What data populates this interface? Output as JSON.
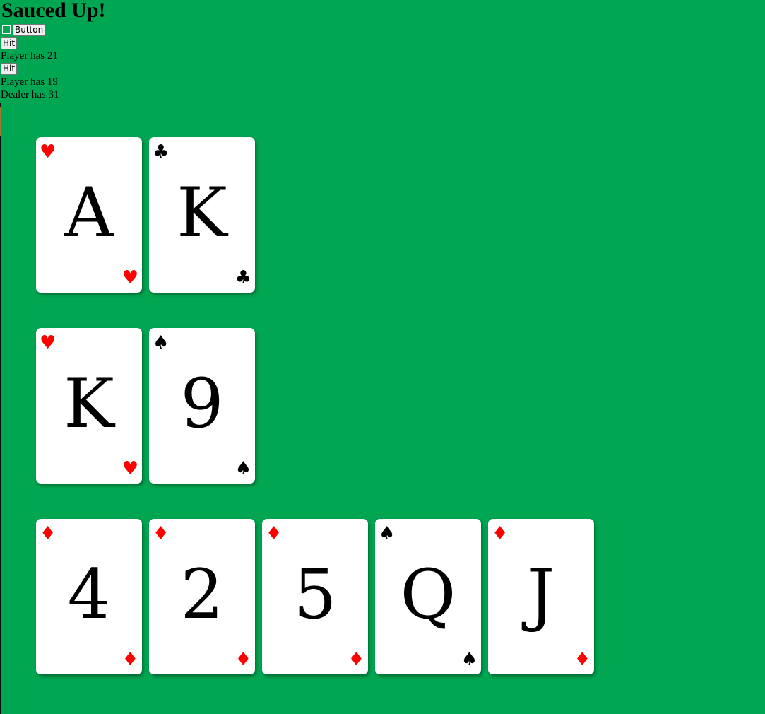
{
  "title": "Sauced Up!",
  "controls": {
    "button_label": "Button",
    "hit_label": "Hit"
  },
  "status": {
    "player1": "Player has 21",
    "player2": "Player has 19",
    "dealer": "Dealer has 31"
  },
  "hands": [
    {
      "cards": [
        {
          "rank": "A",
          "suit": "♥",
          "color": "#ff0000"
        },
        {
          "rank": "K",
          "suit": "♣",
          "color": "#000000"
        }
      ]
    },
    {
      "cards": [
        {
          "rank": "K",
          "suit": "♥",
          "color": "#ff0000"
        },
        {
          "rank": "9",
          "suit": "♠",
          "color": "#000000"
        }
      ]
    },
    {
      "cards": [
        {
          "rank": "4",
          "suit": "♦",
          "color": "#ff0000"
        },
        {
          "rank": "2",
          "suit": "♦",
          "color": "#ff0000"
        },
        {
          "rank": "5",
          "suit": "♦",
          "color": "#ff0000"
        },
        {
          "rank": "Q",
          "suit": "♠",
          "color": "#000000"
        },
        {
          "rank": "J",
          "suit": "♦",
          "color": "#ff0000"
        }
      ]
    }
  ],
  "colors": {
    "table": "#00a651",
    "red_suit": "#ff0000",
    "black_suit": "#000000"
  }
}
